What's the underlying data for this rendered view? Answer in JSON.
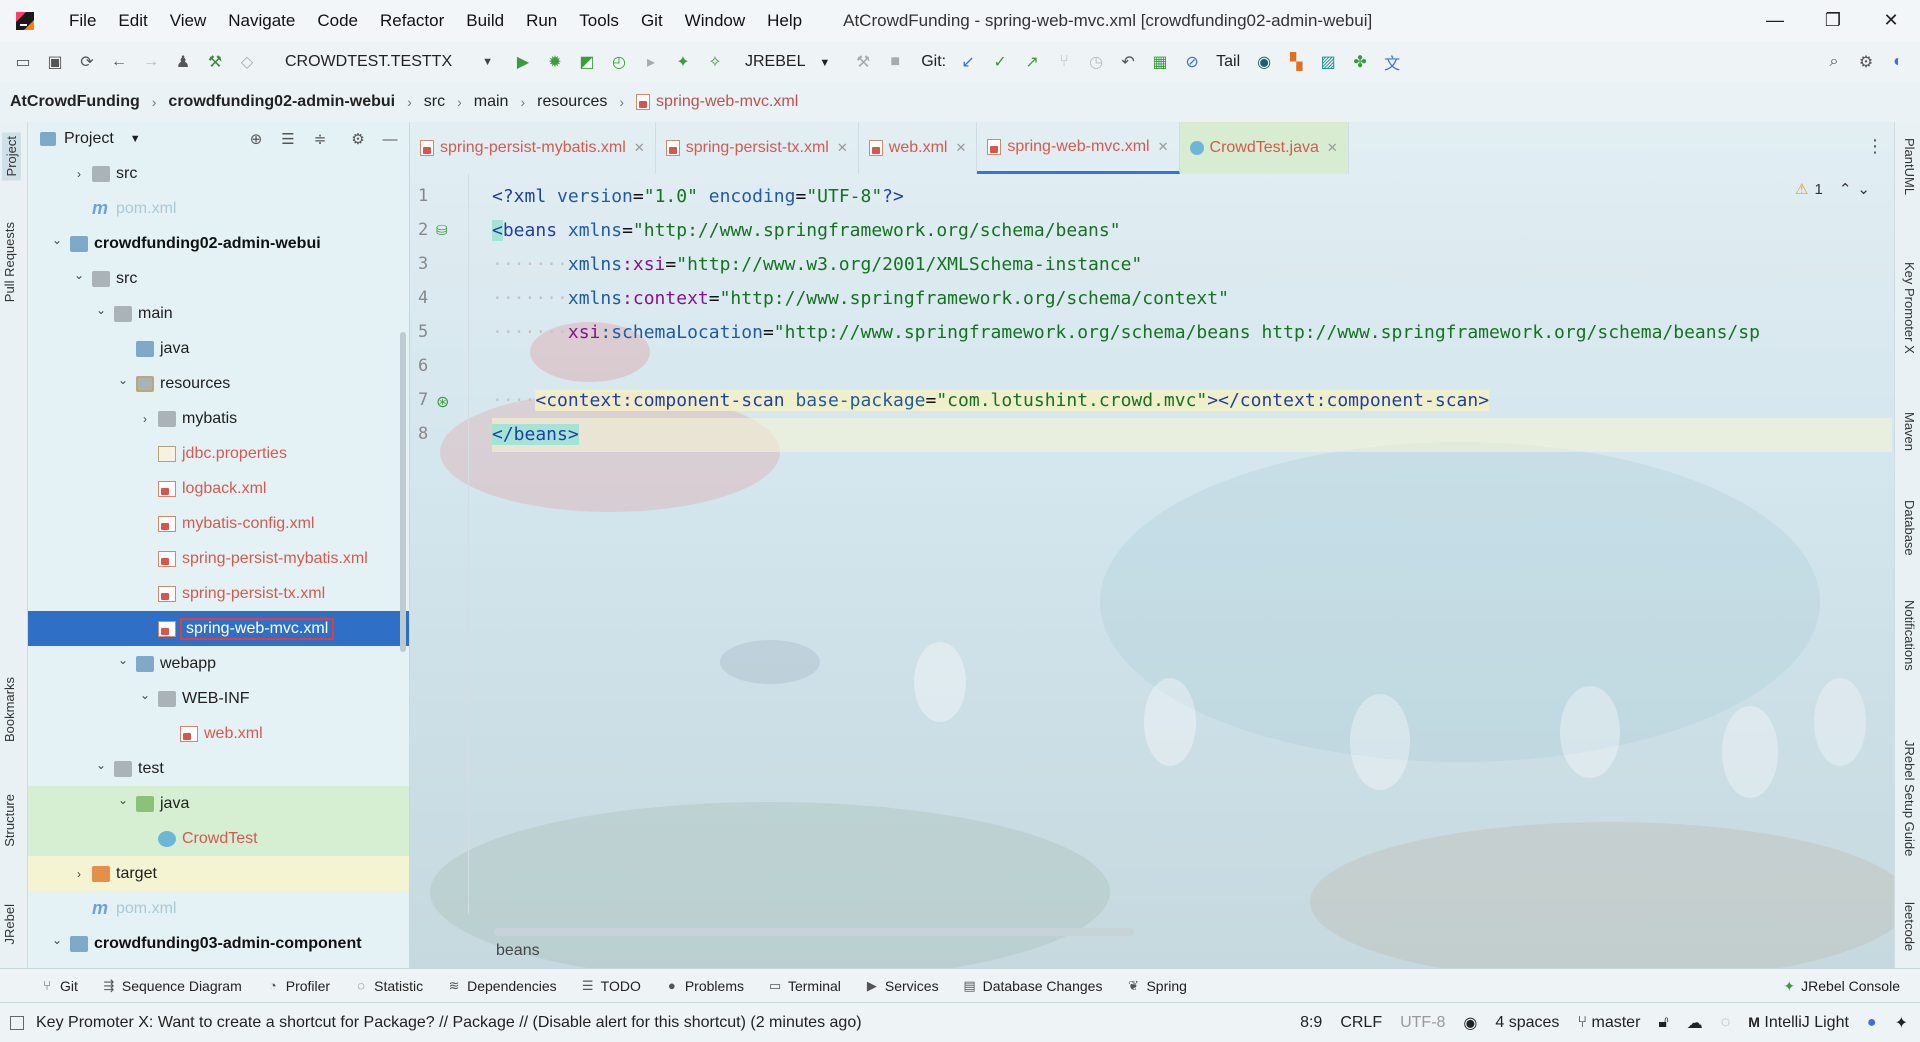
{
  "window": {
    "title": "AtCrowdFunding - spring-web-mvc.xml [crowdfunding02-admin-webui]",
    "menu": [
      "File",
      "Edit",
      "View",
      "Navigate",
      "Code",
      "Refactor",
      "Build",
      "Run",
      "Tools",
      "Git",
      "Window",
      "Help"
    ],
    "controls": {
      "minimize": "—",
      "restore": "❐",
      "close": "✕"
    }
  },
  "toolbar": {
    "run_config": "CROWDTEST.TESTTX",
    "jrebel": "JREBEL",
    "git": "Git:",
    "tail": "Tail"
  },
  "breadcrumb": {
    "project": "AtCrowdFunding",
    "module": "crowdfunding02-admin-webui",
    "parts": [
      "src",
      "main",
      "resources"
    ],
    "file": "spring-web-mvc.xml"
  },
  "left_strip": {
    "project": "Project",
    "pull_requests": "Pull Requests",
    "bookmarks": "Bookmarks",
    "structure": "Structure",
    "jrebel": "JRebel"
  },
  "right_strip": {
    "plantuml": "PlantUML",
    "key_promoter": "Key Promoter X",
    "maven": "Maven",
    "database": "Database",
    "notifications": "Notifications",
    "jrebel_setup": "JRebel Setup Guide",
    "leetcode": "leetcode"
  },
  "project_panel": {
    "title": "Project",
    "tree": [
      {
        "label": "src",
        "indent": 1,
        "arrow": "›",
        "icon": "folder"
      },
      {
        "label": "pom.xml",
        "indent": 1,
        "arrow": "",
        "icon": "maven",
        "style": "faded"
      },
      {
        "label": "crowdfunding02-admin-webui",
        "indent": 0,
        "arrow": "⌄",
        "icon": "folder-module",
        "style": "bold"
      },
      {
        "label": "src",
        "indent": 1,
        "arrow": "⌄",
        "icon": "folder"
      },
      {
        "label": "main",
        "indent": 2,
        "arrow": "⌄",
        "icon": "folder"
      },
      {
        "label": "java",
        "indent": 3,
        "arrow": "",
        "icon": "folder-blue"
      },
      {
        "label": "resources",
        "indent": 3,
        "arrow": "⌄",
        "icon": "folder-res"
      },
      {
        "label": "mybatis",
        "indent": 4,
        "arrow": "›",
        "icon": "folder"
      },
      {
        "label": "jdbc.properties",
        "indent": 4,
        "arrow": "",
        "icon": "props",
        "style": "red"
      },
      {
        "label": "logback.xml",
        "indent": 4,
        "arrow": "",
        "icon": "xml",
        "style": "red"
      },
      {
        "label": "mybatis-config.xml",
        "indent": 4,
        "arrow": "",
        "icon": "xml",
        "style": "red"
      },
      {
        "label": "spring-persist-mybatis.xml",
        "indent": 4,
        "arrow": "",
        "icon": "xml",
        "style": "red"
      },
      {
        "label": "spring-persist-tx.xml",
        "indent": 4,
        "arrow": "",
        "icon": "xml",
        "style": "red"
      },
      {
        "label": "spring-web-mvc.xml",
        "indent": 4,
        "arrow": "",
        "icon": "xml",
        "style": "selected"
      },
      {
        "label": "webapp",
        "indent": 3,
        "arrow": "⌄",
        "icon": "folder-blue"
      },
      {
        "label": "WEB-INF",
        "indent": 4,
        "arrow": "⌄",
        "icon": "folder"
      },
      {
        "label": "web.xml",
        "indent": 5,
        "arrow": "",
        "icon": "xml",
        "style": "red"
      },
      {
        "label": "test",
        "indent": 2,
        "arrow": "⌄",
        "icon": "folder"
      },
      {
        "label": "java",
        "indent": 3,
        "arrow": "⌄",
        "icon": "folder-green",
        "style": "test"
      },
      {
        "label": "CrowdTest",
        "indent": 4,
        "arrow": "",
        "icon": "java",
        "style": "test-red"
      },
      {
        "label": "target",
        "indent": 1,
        "arrow": "›",
        "icon": "folder-orange",
        "style": "target"
      },
      {
        "label": "pom.xml",
        "indent": 1,
        "arrow": "",
        "icon": "maven",
        "style": "faded"
      },
      {
        "label": "crowdfunding03-admin-component",
        "indent": 0,
        "arrow": "⌄",
        "icon": "folder-module",
        "style": "bold"
      }
    ]
  },
  "tabs": [
    {
      "label": "spring-persist-mybatis.xml",
      "icon": "xml"
    },
    {
      "label": "spring-persist-tx.xml",
      "icon": "xml"
    },
    {
      "label": "web.xml",
      "icon": "xml"
    },
    {
      "label": "spring-web-mvc.xml",
      "icon": "xml",
      "active": true
    },
    {
      "label": "CrowdTest.java",
      "icon": "java"
    }
  ],
  "editor": {
    "line_numbers": [
      "1",
      "2",
      "3",
      "4",
      "5",
      "6",
      "7",
      "8"
    ],
    "warnings": "1",
    "breadcrumb": "beans",
    "lines": [
      [
        {
          "t": "<?xml ",
          "c": "tag"
        },
        {
          "t": "version",
          "c": "attr"
        },
        {
          "t": "=",
          "c": "plain"
        },
        {
          "t": "\"1.0\"",
          "c": "str"
        },
        {
          "t": " encoding",
          "c": "attr"
        },
        {
          "t": "=",
          "c": "plain"
        },
        {
          "t": "\"UTF-8\"",
          "c": "str"
        },
        {
          "t": "?>",
          "c": "tag"
        }
      ],
      [
        {
          "t": "<",
          "c": "match"
        },
        {
          "t": "beans",
          "c": "tag"
        },
        {
          "t": " xmlns",
          "c": "attr"
        },
        {
          "t": "=",
          "c": "plain"
        },
        {
          "t": "\"http://www.springframework.org/schema/beans\"",
          "c": "str"
        }
      ],
      [
        {
          "t": "·······",
          "c": "ws"
        },
        {
          "t": "xmlns",
          "c": "attr"
        },
        {
          "t": ":xsi",
          "c": "ns"
        },
        {
          "t": "=",
          "c": "plain"
        },
        {
          "t": "\"http://www.w3.org/2001/XMLSchema-instance\"",
          "c": "str"
        }
      ],
      [
        {
          "t": "·······",
          "c": "ws"
        },
        {
          "t": "xmlns",
          "c": "attr"
        },
        {
          "t": ":context",
          "c": "ns"
        },
        {
          "t": "=",
          "c": "plain"
        },
        {
          "t": "\"http://www.springframework.org/schema/context\"",
          "c": "str"
        }
      ],
      [
        {
          "t": "·······",
          "c": "ws"
        },
        {
          "t": "xsi",
          "c": "ns"
        },
        {
          "t": ":schemaLocation",
          "c": "attr"
        },
        {
          "t": "=",
          "c": "plain"
        },
        {
          "t": "\"http://www.springframework.org/schema/beans http://www.springframework.org/schema/beans/sp",
          "c": "str"
        }
      ],
      [],
      [
        {
          "t": "····",
          "c": "ws"
        },
        {
          "t": "<context:component-scan",
          "c": "tag"
        },
        {
          "t": " base-package",
          "c": "attr"
        },
        {
          "t": "=",
          "c": "plain"
        },
        {
          "t": "\"com.lotushint.crowd.mvc\"",
          "c": "str"
        },
        {
          "t": "></context:component-scan>",
          "c": "tag"
        }
      ],
      [
        {
          "t": "</beans>",
          "c": "match-tag"
        }
      ]
    ]
  },
  "tool_tabs": [
    "Git",
    "Sequence Diagram",
    "Profiler",
    "Statistic",
    "Dependencies",
    "TODO",
    "Problems",
    "Terminal",
    "Services",
    "Database Changes",
    "Spring"
  ],
  "tool_right": "JRebel Console",
  "status": {
    "message": "Key Promoter X: Want to create a shortcut for Package? // Package // (Disable alert for this shortcut) (2 minutes ago)",
    "position": "8:9",
    "line_sep": "CRLF",
    "encoding": "UTF-8",
    "indent": "4 spaces",
    "branch": "master",
    "theme": "IntelliJ Light"
  },
  "colors": {
    "accent": "#3874d8",
    "selection": "#2f6fc5",
    "vcs_new": "#d45a4f"
  }
}
